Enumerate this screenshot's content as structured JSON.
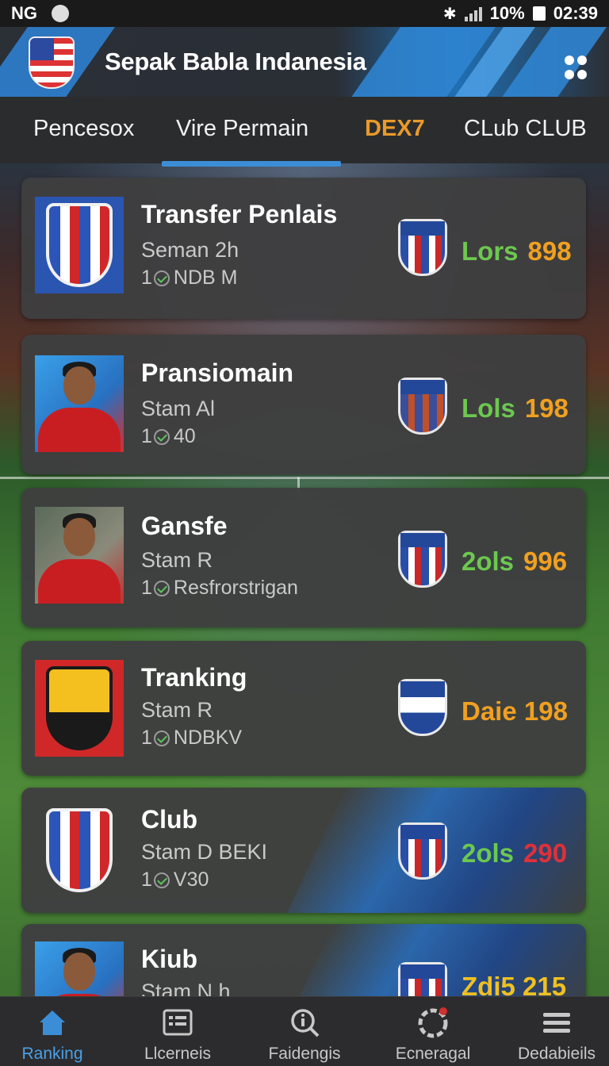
{
  "status_bar": {
    "carrier": "NG",
    "battery": "10%",
    "time": "02:39"
  },
  "header": {
    "title": "Sepak Babla Indanesia",
    "logo_icon": "flag-shield-icon",
    "menu_icon": "dots-grid-icon"
  },
  "tabs": [
    {
      "label": "Pencesox",
      "active": false
    },
    {
      "label": "Vire Permain",
      "active": false
    },
    {
      "label": "DEX7",
      "active": true
    },
    {
      "label": "CLub CLUB",
      "active": false
    }
  ],
  "cards": [
    {
      "name": "Transfer Penlais",
      "sub": "Seman 2h",
      "meta_prefix": "1",
      "meta": "NDB M",
      "stat_a": "Lors",
      "stat_b": "898",
      "thumb_type": "shield"
    },
    {
      "name": "Pransiomain",
      "sub": "Stam Al",
      "meta_prefix": "1",
      "meta": "40",
      "stat_a": "Lols",
      "stat_b": "198",
      "thumb_type": "player"
    },
    {
      "name": "Gansfe",
      "sub": "Stam R",
      "meta_prefix": "1",
      "meta": "Resfrorstrigan",
      "stat_a": "2ols",
      "stat_b": "996",
      "thumb_type": "player"
    },
    {
      "name": "Tranking",
      "sub": "Stam R",
      "meta_prefix": "1",
      "meta": "NDBKV",
      "stat_a": "",
      "stat_b": "Daie 198",
      "thumb_type": "yellow-shield"
    },
    {
      "name": "Club",
      "sub": "Stam D BEKI",
      "meta_prefix": "1",
      "meta": "V30",
      "stat_a": "2ols",
      "stat_b": "290",
      "thumb_type": "shield"
    },
    {
      "name": "Kiub",
      "sub": "Stam N h",
      "meta_prefix": "",
      "meta": "",
      "stat_a": "",
      "stat_b": "Zdi5 215",
      "thumb_type": "player"
    }
  ],
  "bottom_nav": [
    {
      "label": "Ranking",
      "icon": "home-icon",
      "active": true
    },
    {
      "label": "Llcerneis",
      "icon": "list-icon",
      "active": false
    },
    {
      "label": "Faidengis",
      "icon": "search-info-icon",
      "active": false
    },
    {
      "label": "Ecneragal",
      "icon": "ball-icon",
      "active": false
    },
    {
      "label": "Dedabieils",
      "icon": "menu-icon",
      "active": false
    }
  ],
  "colors": {
    "accent_blue": "#3b8ed6",
    "active_tab": "#e89a2a",
    "stat_green": "#6cc84f",
    "stat_orange": "#f0a020",
    "stat_red": "#e0303a"
  }
}
